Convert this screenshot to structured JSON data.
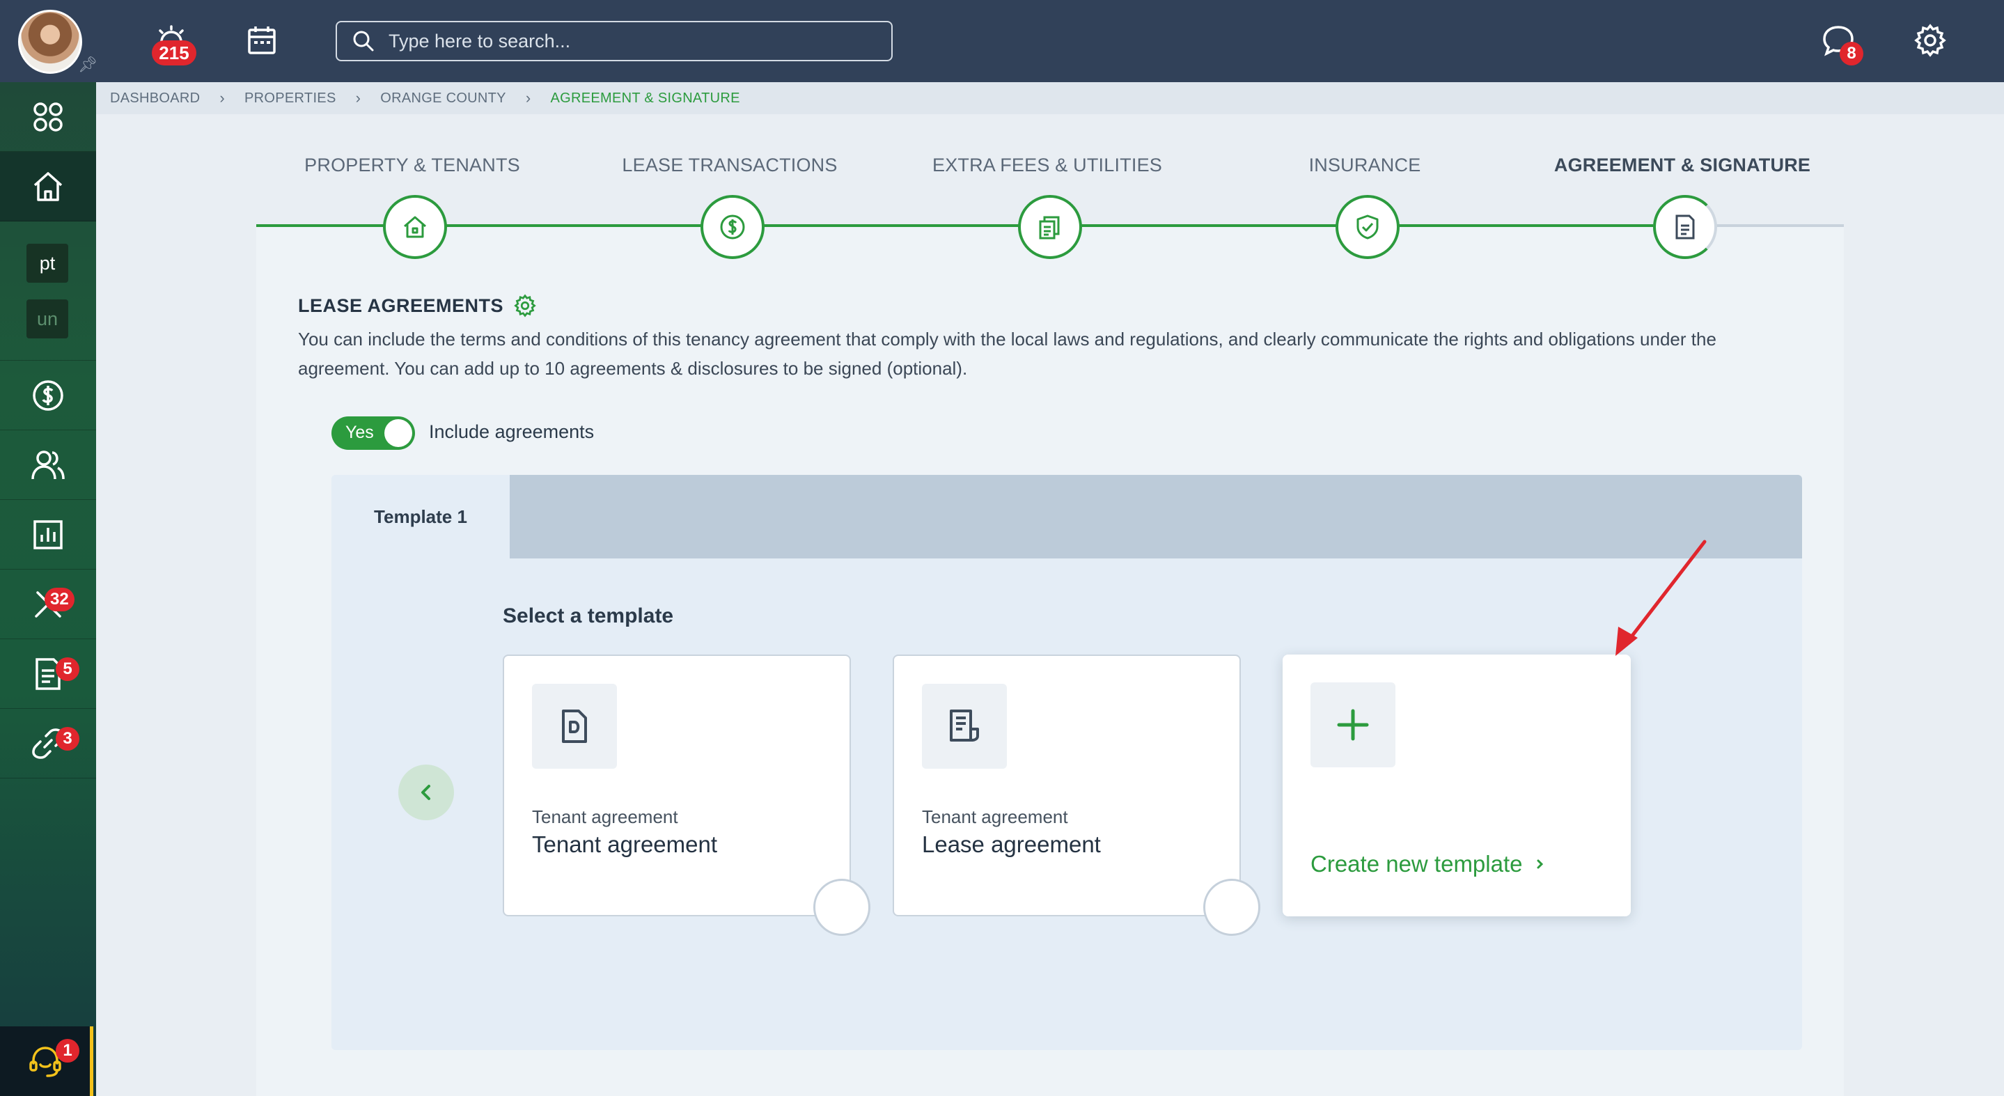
{
  "header": {
    "alarm_badge": "215",
    "chat_badge": "8",
    "search_placeholder": "Type here to search..."
  },
  "sidebar": {
    "chip_pt": "pt",
    "chip_un": "un",
    "maintenance_badge": "32",
    "documents_badge": "5",
    "links_badge": "3",
    "support_badge": "1"
  },
  "breadcrumb": [
    "DASHBOARD",
    "PROPERTIES",
    "ORANGE COUNTY",
    "AGREEMENT & SIGNATURE"
  ],
  "steps": [
    {
      "label": "PROPERTY & TENANTS",
      "icon": "house-icon"
    },
    {
      "label": "LEASE TRANSACTIONS",
      "icon": "dollar-icon"
    },
    {
      "label": "EXTRA FEES & UTILITIES",
      "icon": "bills-icon"
    },
    {
      "label": "INSURANCE",
      "icon": "shield-icon"
    },
    {
      "label": "AGREEMENT & SIGNATURE",
      "icon": "document-icon"
    }
  ],
  "lease": {
    "title": "LEASE AGREEMENTS",
    "description": "You can include the terms and conditions of this tenancy agreement that comply with the local laws and regulations, and clearly communicate the rights and obligations under the agreement. You can add up to 10 agreements & disclosures to be signed (optional).",
    "toggle_value": "Yes",
    "toggle_label": "Include agreements"
  },
  "templates": {
    "tab_label": "Template 1",
    "select_title": "Select a template",
    "cards": [
      {
        "subtitle": "Tenant agreement",
        "title": "Tenant agreement"
      },
      {
        "subtitle": "Tenant agreement",
        "title": "Lease agreement"
      }
    ],
    "create_label": "Create new template"
  },
  "colors": {
    "accent": "#2c9b3e",
    "topbar": "#314159",
    "badge": "#e0262d",
    "annotation_arrow": "#e0262d"
  }
}
